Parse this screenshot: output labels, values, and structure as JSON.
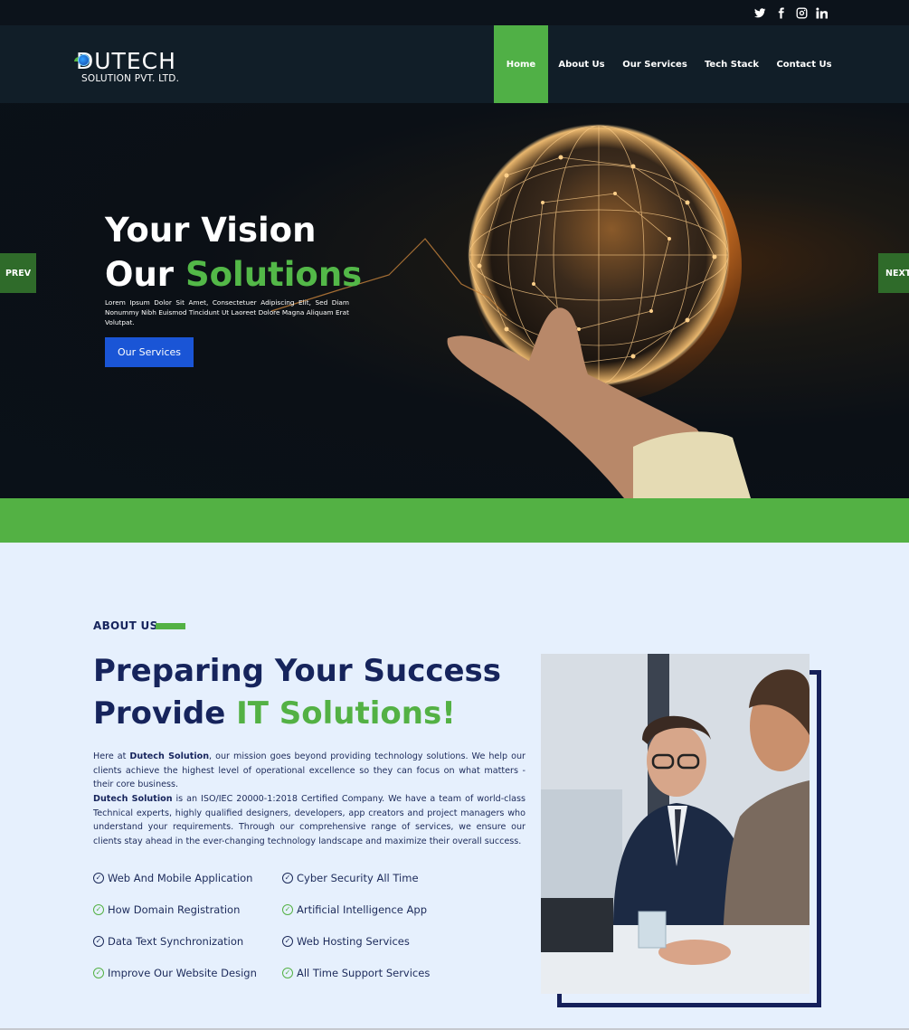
{
  "topbar": {
    "social_icons": [
      "twitter-icon",
      "facebook-icon",
      "instagram-icon",
      "linkedin-icon"
    ]
  },
  "header": {
    "logo": {
      "main": "DUTECH",
      "sub": "SOLUTION PVT. LTD."
    },
    "nav": [
      "Home",
      "About Us",
      "Our Services",
      "Tech Stack",
      "Contact Us"
    ],
    "active_nav": "Home"
  },
  "hero": {
    "title_line1": "Your Vision",
    "title_line2_a": "Our ",
    "title_line2_b": "Solutions",
    "text": "Lorem Ipsum Dolor Sit Amet, Consectetuer Adipiscing Elit, Sed Diam Nonummy Nibh Euismod Tincidunt Ut Laoreet Dolore Magna Aliquam Erat Volutpat.",
    "button": "Our Services",
    "prev": "PREV",
    "next": "NEXT"
  },
  "about": {
    "label": "ABOUT US",
    "title_line1": "Preparing Your Success",
    "title_line2_a": "Provide ",
    "title_line2_b": "IT Solutions!",
    "p1_a": "Here at ",
    "p1_b": "Dutech Solution",
    "p1_c": ", our mission goes beyond providing technology solutions. We help our clients achieve the highest level of operational excellence so they can focus on what matters - their core business.",
    "p2_a": "Dutech Solution",
    "p2_b": " is an ISO/IEC 20000-1:2018 Certified Company. We have a team of world-class Technical experts, highly qualified designers, developers, app creators and project managers who understand your requirements. Through our comprehensive range of services, we ensure our clients stay ahead in the ever-changing technology landscape and maximize their overall success.",
    "features_left": [
      "Web And Mobile Application",
      "How Domain Registration",
      "Data Text Synchronization",
      "Improve Our Website Design"
    ],
    "features_right": [
      "Cyber Security All Time",
      "Artificial Intelligence App",
      "Web Hosting Services",
      "All Time Support Services"
    ]
  },
  "colors": {
    "green": "#53b144",
    "navy": "#16245c",
    "blue_button": "#1a55d6",
    "header_bg": "#111e28"
  }
}
